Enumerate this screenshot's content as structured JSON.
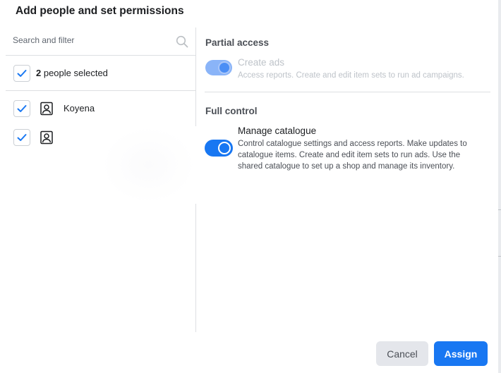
{
  "dialog": {
    "title": "Add people and set permissions"
  },
  "left_pane": {
    "search": {
      "placeholder": "Search and filter",
      "value": ""
    },
    "selected": {
      "count": "2",
      "label": " people selected"
    },
    "people": [
      {
        "name": "Koyena",
        "checked": true
      },
      {
        "name": "",
        "checked": true
      }
    ]
  },
  "right_pane": {
    "partial_access": {
      "title": "Partial access",
      "permission": {
        "label": "Create ads",
        "description": "Access reports. Create and edit item sets to run ad campaigns.",
        "enabled": true,
        "disabled_state": true
      }
    },
    "full_control": {
      "title": "Full control",
      "permission": {
        "label": "Manage catalogue",
        "description": "Control catalogue settings and access reports. Make updates to catalogue items. Create and edit item sets to run ads. Use the shared catalogue to set up a shop and manage its inventory.",
        "enabled": true,
        "disabled_state": false
      }
    }
  },
  "footer": {
    "cancel_label": "Cancel",
    "assign_label": "Assign"
  },
  "colors": {
    "accent": "#1877f2",
    "accent_disabled": "#8ab4f8",
    "text_primary": "#1c1e21",
    "text_muted": "#bec3c9",
    "divider": "#dddfe2"
  }
}
